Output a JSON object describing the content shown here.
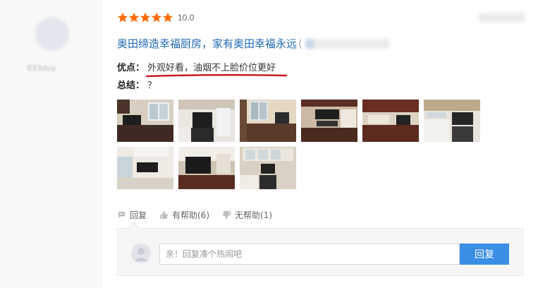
{
  "reviewer": {
    "name": "833duy",
    "meta": ""
  },
  "review": {
    "stars": 5,
    "score": "10.0",
    "title": "奥田缔造幸福厨房，家有奥田幸福永远",
    "title_paren": "(",
    "pros_label": "优点：",
    "pros_text": "外观好看，油烟不上脸价位更好",
    "summary_label": "总结：",
    "summary_text": "？"
  },
  "photos": [
    {
      "scene": "kitchen-window-dark-cabinets"
    },
    {
      "scene": "kitchen-white-range"
    },
    {
      "scene": "kitchen-window-wood"
    },
    {
      "scene": "kitchen-hood-stove"
    },
    {
      "scene": "kitchen-cherry-cabinets"
    },
    {
      "scene": "kitchen-tiled-hood"
    },
    {
      "scene": "kitchen-white-cabinets"
    },
    {
      "scene": "kitchen-stove-closeup"
    },
    {
      "scene": "kitchen-glass-cabinets"
    }
  ],
  "actions": {
    "reply_label": "回复",
    "helpful_label": "有帮助(6)",
    "unhelpful_label": "无帮助(1)"
  },
  "reply_form": {
    "placeholder": "亲！回复凑个热闹吧",
    "submit_label": "回复"
  },
  "colors": {
    "star": "#ff6a00",
    "title_link": "#1f67b2",
    "underline": "#c8161d",
    "button": "#3a8ee6"
  }
}
